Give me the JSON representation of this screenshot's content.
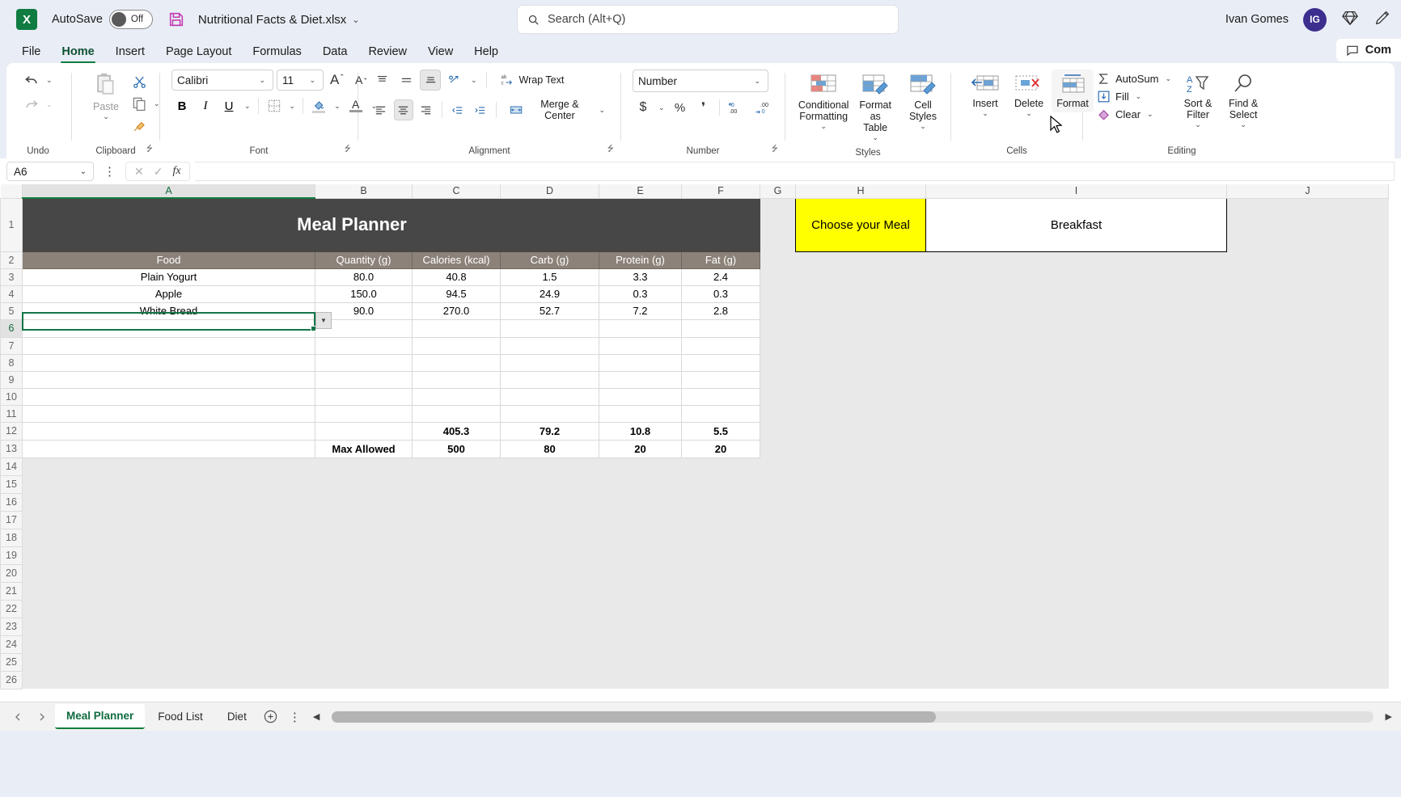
{
  "titlebar": {
    "app_logo": "X",
    "autosave_label": "AutoSave",
    "autosave_state": "Off",
    "save_icon": "save-icon",
    "document_title": "Nutritional Facts & Diet.xlsx",
    "title_chevron": "⌄",
    "user_name": "Ivan Gomes",
    "avatar_initials": "IG",
    "diamond_icon": "diamond-icon",
    "pen_icon": "pen-icon"
  },
  "search": {
    "placeholder": "Search (Alt+Q)",
    "icon": "search-icon"
  },
  "ribbon_tabs": [
    {
      "label": "File",
      "active": false
    },
    {
      "label": "Home",
      "active": true
    },
    {
      "label": "Insert",
      "active": false
    },
    {
      "label": "Page Layout",
      "active": false
    },
    {
      "label": "Formulas",
      "active": false
    },
    {
      "label": "Data",
      "active": false
    },
    {
      "label": "Review",
      "active": false
    },
    {
      "label": "View",
      "active": false
    },
    {
      "label": "Help",
      "active": false
    }
  ],
  "comments_button": {
    "label": "Com",
    "icon": "comment-icon"
  },
  "ribbon": {
    "undo_group": {
      "label": "Undo",
      "undo_icon": "undo-arrow-icon",
      "redo_icon": "redo-arrow-icon"
    },
    "clipboard_group": {
      "label": "Clipboard",
      "paste_label": "Paste",
      "paste_icon": "clipboard-icon",
      "cut_icon": "scissors-icon",
      "copy_icon": "copy-icon",
      "format_painter_icon": "format-painter-icon",
      "dialog_launcher": "⭍"
    },
    "font_group": {
      "label": "Font",
      "font_name": "Calibri",
      "font_size": "11",
      "grow_font_icon": "grow-font-icon",
      "shrink_font_icon": "shrink-font-icon",
      "bold_label": "B",
      "italic_label": "I",
      "underline_label": "U",
      "borders_icon": "borders-icon",
      "fill_color_icon": "fill-color-icon",
      "font_color_icon": "font-color-icon",
      "dialog_launcher": "⭍"
    },
    "alignment_group": {
      "label": "Alignment",
      "align_top_icon": "align-top-icon",
      "align_middle_icon": "align-middle-icon",
      "align_bottom_icon": "align-bottom-icon",
      "orientation_icon": "orientation-icon",
      "align_left_icon": "align-left-icon",
      "align_center_icon": "align-center-icon",
      "align_right_icon": "align-right-icon",
      "decrease_indent_icon": "decrease-indent-icon",
      "increase_indent_icon": "increase-indent-icon",
      "wrap_text_label": "Wrap Text",
      "wrap_text_icon": "wrap-text-icon",
      "merge_center_label": "Merge & Center",
      "merge_center_icon": "merge-cells-icon",
      "dialog_launcher": "⭍"
    },
    "number_group": {
      "label": "Number",
      "number_format": "Number",
      "currency_label": "$",
      "percent_label": "%",
      "comma_label": "❜",
      "increase_decimal_icon": "increase-decimal-icon",
      "decrease_decimal_icon": "decrease-decimal-icon",
      "dialog_launcher": "⭍"
    },
    "styles_group": {
      "label": "Styles",
      "conditional_formatting_label": "Conditional\nFormatting",
      "format_as_table_label": "Format as\nTable",
      "cell_styles_label": "Cell\nStyles"
    },
    "cells_group": {
      "label": "Cells",
      "insert_label": "Insert",
      "delete_label": "Delete",
      "format_label": "Format",
      "format_hovered": true
    },
    "editing_group": {
      "label": "Editing",
      "autosum_label": "AutoSum",
      "fill_label": "Fill",
      "clear_label": "Clear",
      "sort_filter_label": "Sort &\nFilter",
      "find_select_label": "Find &\nSelect"
    }
  },
  "formula_bar": {
    "name_box": "A6",
    "cancel_icon": "cancel-x-icon",
    "confirm_icon": "confirm-check-icon",
    "function_icon": "fx",
    "formula_value": ""
  },
  "grid": {
    "columns": [
      "A",
      "B",
      "C",
      "D",
      "E",
      "F",
      "G",
      "H",
      "I",
      "J"
    ],
    "selected_column": "A",
    "selected_row": 6,
    "selected_cell": "A6",
    "row_numbers": [
      1,
      2,
      3,
      4,
      5,
      6,
      7,
      8,
      9,
      10,
      11,
      12,
      13,
      14,
      15,
      16,
      17,
      18,
      19,
      20,
      21,
      22,
      23,
      24,
      25,
      26
    ],
    "sheet_title": "Meal Planner",
    "headers": [
      "Food",
      "Quantity (g)",
      "Calories (kcal)",
      "Carb (g)",
      "Protein (g)",
      "Fat (g)"
    ],
    "rows": [
      {
        "row": 3,
        "food": "Plain Yogurt",
        "quantity": "80.0",
        "calories": "40.8",
        "carb": "1.5",
        "protein": "3.3",
        "fat": "2.4"
      },
      {
        "row": 4,
        "food": "Apple",
        "quantity": "150.0",
        "calories": "94.5",
        "carb": "24.9",
        "protein": "0.3",
        "fat": "0.3"
      },
      {
        "row": 5,
        "food": "White Bread",
        "quantity": "90.0",
        "calories": "270.0",
        "carb": "52.7",
        "protein": "7.2",
        "fat": "2.8"
      },
      {
        "row": 6,
        "food": "",
        "quantity": "",
        "calories": "",
        "carb": "",
        "protein": "",
        "fat": ""
      },
      {
        "row": 7,
        "food": "",
        "quantity": "",
        "calories": "",
        "carb": "",
        "protein": "",
        "fat": ""
      },
      {
        "row": 8,
        "food": "",
        "quantity": "",
        "calories": "",
        "carb": "",
        "protein": "",
        "fat": ""
      },
      {
        "row": 9,
        "food": "",
        "quantity": "",
        "calories": "",
        "carb": "",
        "protein": "",
        "fat": ""
      },
      {
        "row": 10,
        "food": "",
        "quantity": "",
        "calories": "",
        "carb": "",
        "protein": "",
        "fat": ""
      },
      {
        "row": 11,
        "food": "",
        "quantity": "",
        "calories": "",
        "carb": "",
        "protein": "",
        "fat": ""
      }
    ],
    "totals_row": {
      "row": 12,
      "label": "",
      "calories": "405.3",
      "carb": "79.2",
      "protein": "10.8",
      "fat": "5.5"
    },
    "max_allowed_row": {
      "row": 13,
      "label": "Max Allowed",
      "calories": "500",
      "carb": "80",
      "protein": "20",
      "fat": "20"
    },
    "meal_selector": {
      "prompt_label": "Choose your Meal",
      "selected_value": "Breakfast"
    }
  },
  "sheet_tabs": [
    {
      "label": "Meal Planner",
      "active": true
    },
    {
      "label": "Food List",
      "active": false
    },
    {
      "label": "Diet",
      "active": false
    }
  ],
  "sheet_bar": {
    "add_sheet_icon": "plus-circle-icon",
    "options_icon": "more-options-icon",
    "scroll_left_icon": "◀",
    "scroll_right_icon": "▶"
  },
  "colors": {
    "accent_green": "#107c41",
    "title_dark": "#474747",
    "header_gray": "#8c8279",
    "highlight_yellow": "#fce79a",
    "choose_meal_yellow": "#ffff00",
    "avatar_purple": "#3b2e8e"
  }
}
